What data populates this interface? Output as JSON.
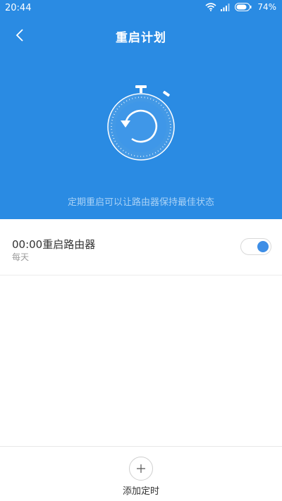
{
  "status_bar": {
    "time": "20:44",
    "battery": "74%",
    "icons": [
      "wifi-icon",
      "signal-icon",
      "battery-icon"
    ]
  },
  "header": {
    "back_icon": "back-arrow-icon",
    "title": "重启计划"
  },
  "hero": {
    "illustration_icon": "stopwatch-restart-icon",
    "subtitle": "定期重启可以让路由器保持最佳状态"
  },
  "schedule": {
    "items": [
      {
        "title": "00:00重启路由器",
        "repeat": "每天",
        "enabled": true
      }
    ]
  },
  "bottom": {
    "add_icon": "plus-icon",
    "add_label": "添加定时"
  },
  "colors": {
    "primary": "#2a8be3",
    "toggle_on": "#3e8ee6",
    "text": "#333333",
    "subtext": "#9a9a9a"
  }
}
